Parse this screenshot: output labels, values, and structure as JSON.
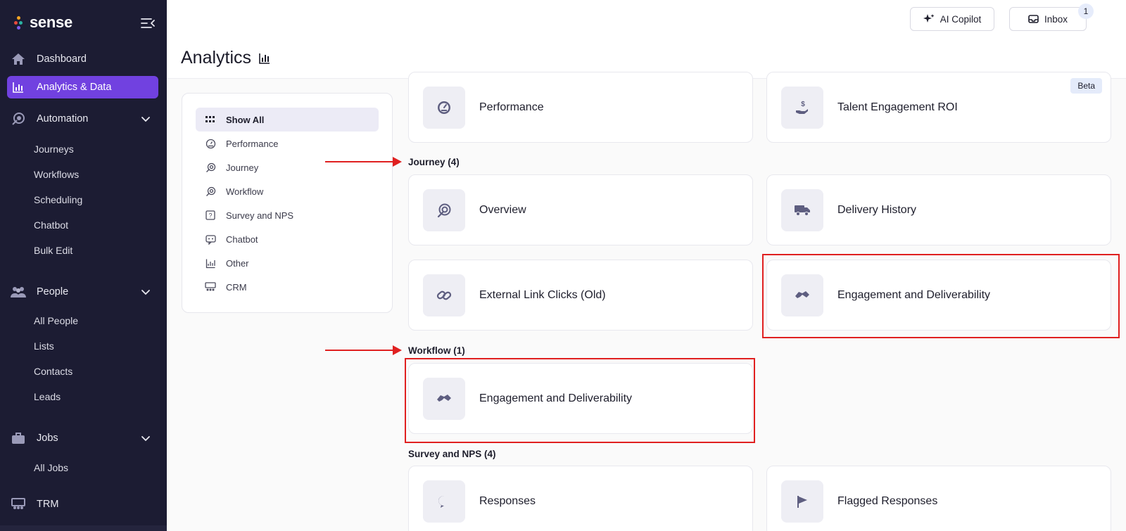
{
  "brand": {
    "name": "sense"
  },
  "sidebar": {
    "items": [
      {
        "label": "Dashboard"
      },
      {
        "label": "Analytics & Data"
      },
      {
        "label": "Automation"
      },
      {
        "label": "People"
      },
      {
        "label": "Jobs"
      },
      {
        "label": "TRM"
      }
    ],
    "automation_sub": [
      "Journeys",
      "Workflows",
      "Scheduling",
      "Chatbot",
      "Bulk Edit"
    ],
    "people_sub": [
      "All People",
      "Lists",
      "Contacts",
      "Leads"
    ],
    "jobs_sub": [
      "All Jobs"
    ]
  },
  "header": {
    "title": "Analytics",
    "copilot_label": "AI Copilot",
    "inbox_label": "Inbox",
    "inbox_count": "1"
  },
  "filters": [
    "Show All",
    "Performance",
    "Journey",
    "Workflow",
    "Survey and NPS",
    "Chatbot",
    "Other",
    "CRM"
  ],
  "sections": {
    "journey": "Journey (4)",
    "workflow": "Workflow (1)",
    "survey": "Survey and NPS (4)"
  },
  "cards": {
    "performance": "Performance",
    "talent_roi": "Talent Engagement ROI",
    "beta": "Beta",
    "overview": "Overview",
    "delivery_history": "Delivery History",
    "external_link": "External Link Clicks (Old)",
    "engagement_journey": "Engagement and Deliverability",
    "engagement_workflow": "Engagement and Deliverability",
    "responses": "Responses",
    "flagged": "Flagged Responses"
  },
  "colors": {
    "sidebar_bg": "#1c1c33",
    "active_nav": "#7141e0",
    "icon_tint": "#5a5a7a",
    "annotation_red": "#e02020"
  }
}
